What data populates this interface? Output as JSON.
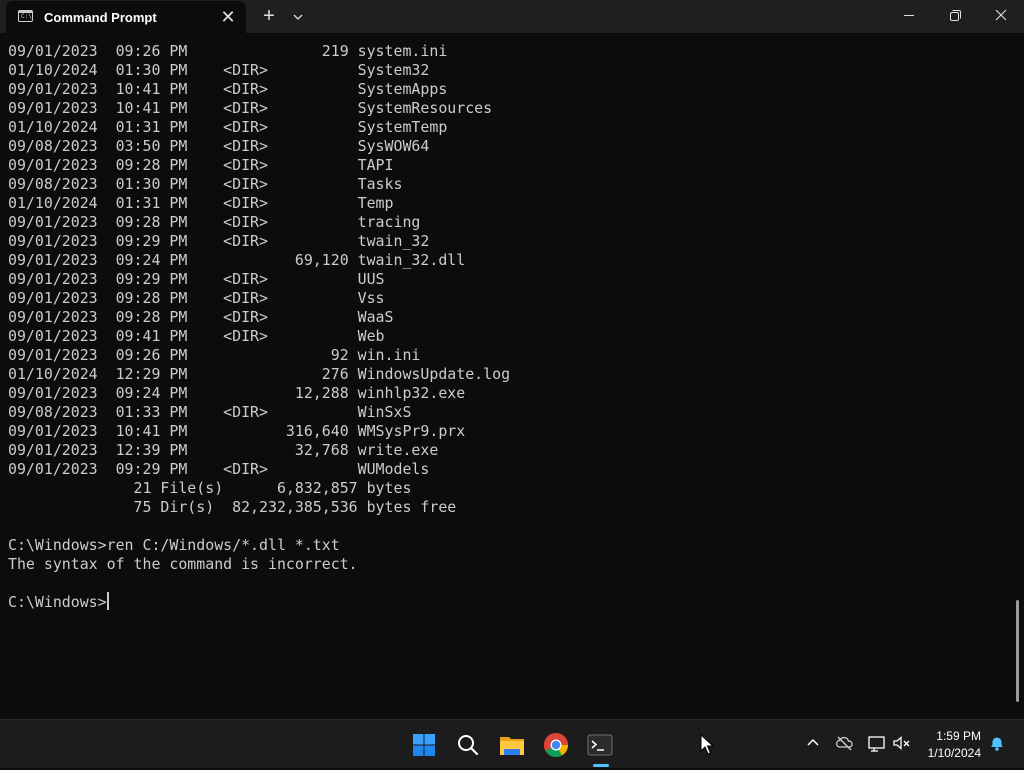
{
  "window": {
    "tab_title": "Command Prompt",
    "tab_close": "✕",
    "new_tab": "+"
  },
  "terminal": {
    "lines": [
      "09/01/2023  09:26 PM               219 system.ini",
      "01/10/2024  01:30 PM    <DIR>          System32",
      "09/01/2023  10:41 PM    <DIR>          SystemApps",
      "09/01/2023  10:41 PM    <DIR>          SystemResources",
      "01/10/2024  01:31 PM    <DIR>          SystemTemp",
      "09/08/2023  03:50 PM    <DIR>          SysWOW64",
      "09/01/2023  09:28 PM    <DIR>          TAPI",
      "09/08/2023  01:30 PM    <DIR>          Tasks",
      "01/10/2024  01:31 PM    <DIR>          Temp",
      "09/01/2023  09:28 PM    <DIR>          tracing",
      "09/01/2023  09:29 PM    <DIR>          twain_32",
      "09/01/2023  09:24 PM            69,120 twain_32.dll",
      "09/01/2023  09:29 PM    <DIR>          UUS",
      "09/01/2023  09:28 PM    <DIR>          Vss",
      "09/01/2023  09:28 PM    <DIR>          WaaS",
      "09/01/2023  09:41 PM    <DIR>          Web",
      "09/01/2023  09:26 PM                92 win.ini",
      "01/10/2024  12:29 PM               276 WindowsUpdate.log",
      "09/01/2023  09:24 PM            12,288 winhlp32.exe",
      "09/08/2023  01:33 PM    <DIR>          WinSxS",
      "09/01/2023  10:41 PM           316,640 WMSysPr9.prx",
      "09/01/2023  12:39 PM            32,768 write.exe",
      "09/01/2023  09:29 PM    <DIR>          WUModels",
      "              21 File(s)      6,832,857 bytes",
      "              75 Dir(s)  82,232,385,536 bytes free",
      "",
      "C:\\Windows>ren C:/Windows/*.dll *.txt",
      "The syntax of the command is incorrect.",
      "",
      "C:\\Windows>"
    ]
  },
  "taskbar": {
    "apps": [
      "start-icon",
      "search-icon",
      "file-explorer-icon",
      "chrome-icon",
      "terminal-icon"
    ],
    "active_app": "terminal-icon",
    "tray_icons": [
      "chevron-up-icon",
      "onedrive-icon",
      "network-icon",
      "volume-muted-icon",
      "notification-bell-icon"
    ],
    "clock": {
      "time": "1:59 PM",
      "date": "1/10/2024"
    },
    "accent_color": "#4cc2ff"
  }
}
